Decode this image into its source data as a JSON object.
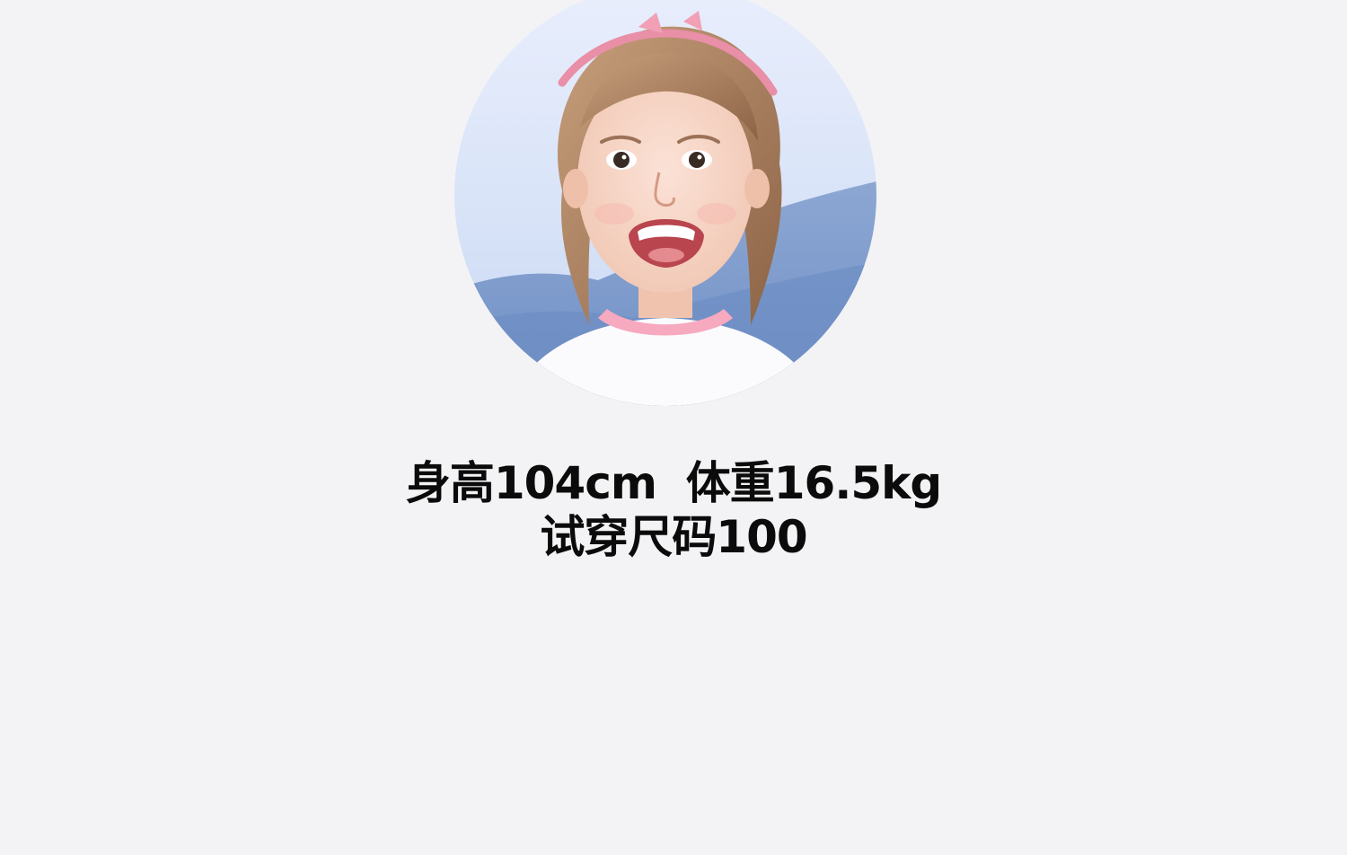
{
  "model_info": {
    "line1": "身高104cm  体重16.5kg",
    "line2": "试穿尺码100"
  },
  "portrait": {
    "icon": "model-photo"
  },
  "colors": {
    "background": "#f3f3f5",
    "text": "#0b0b0b"
  }
}
